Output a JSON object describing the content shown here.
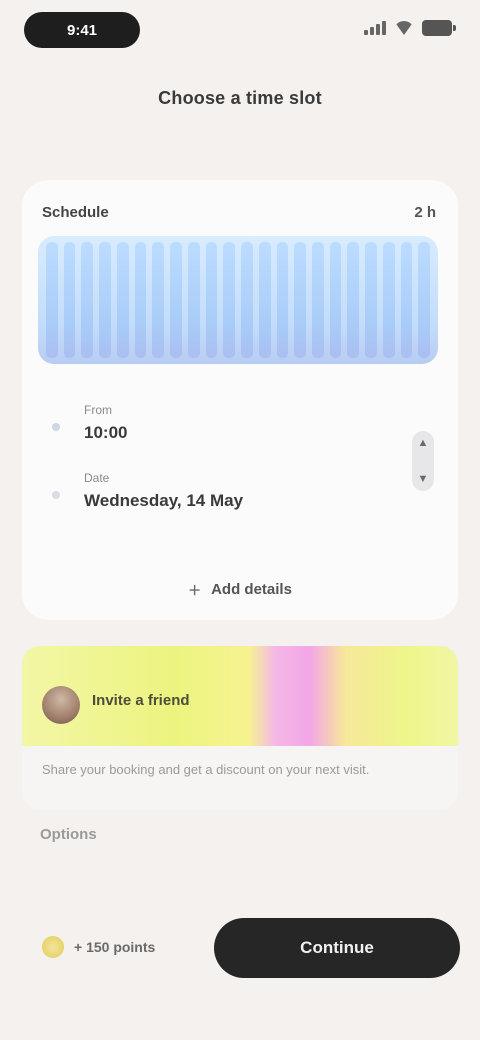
{
  "status_bar": {
    "time": "9:41"
  },
  "header": {
    "title": "Choose a time slot"
  },
  "card": {
    "label": "Schedule",
    "count": "2 h",
    "bars_count": 22,
    "start_label": "From",
    "start_value": "10:00",
    "end_label": "Date",
    "end_value": "Wednesday, 14 May",
    "link_text": "Add details"
  },
  "banner": {
    "title": "Invite a friend",
    "subtitle": "Share your booking and get a discount on your next visit."
  },
  "section": {
    "label": "Options"
  },
  "footer": {
    "points_text": "+ 150 points",
    "primary_button": "Continue"
  },
  "colors": {
    "accent": "#262626",
    "bar_blue": "#a9ccf8",
    "banner_yellow": "#ecf47f",
    "banner_pink": "#f3a6e8"
  },
  "icons": {
    "coin": "coin-icon",
    "link": "plus-icon",
    "stepper_up": "chevron-up-icon",
    "stepper_down": "chevron-down-icon"
  }
}
